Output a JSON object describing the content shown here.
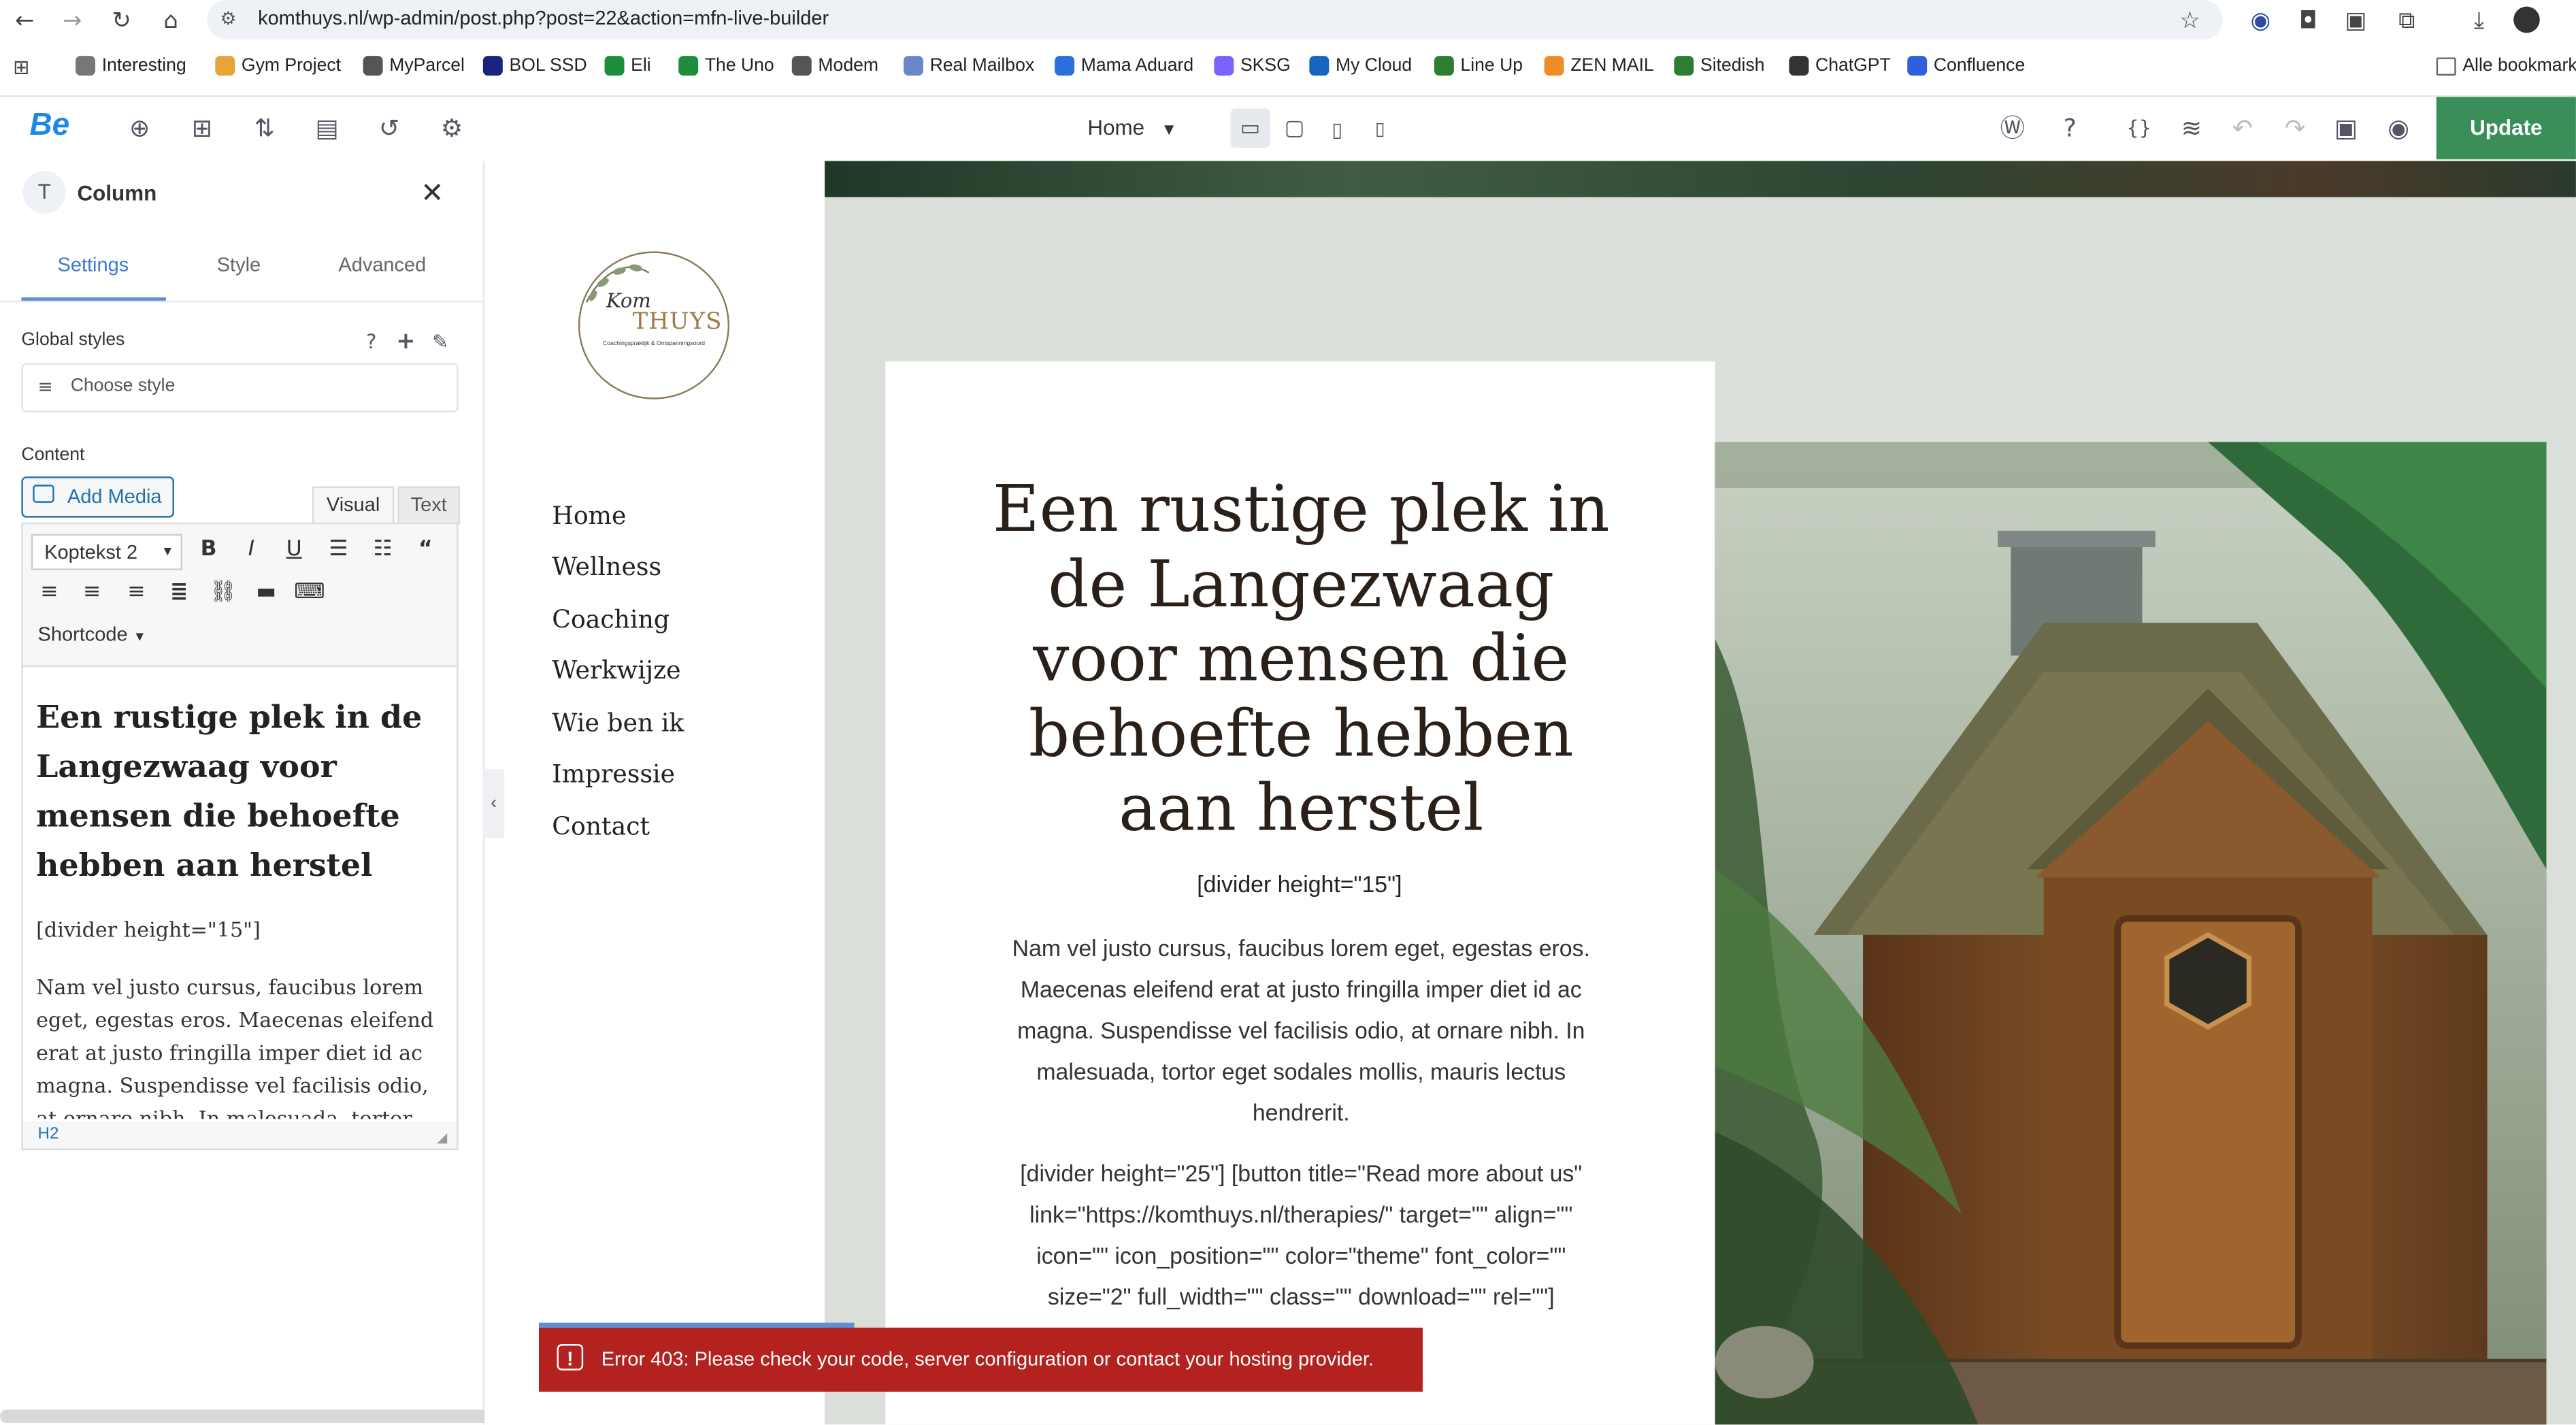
{
  "browser": {
    "url": "komthuys.nl/wp-admin/post.php?post=22&action=mfn-live-builder",
    "bookmarks": [
      "Interesting",
      "Gym Project",
      "MyParcel",
      "BOL SSD",
      "Eli",
      "The Uno",
      "Modem",
      "Real Mailbox",
      "Mama Aduard",
      "SKSG",
      "My Cloud",
      "Line Up",
      "ZEN MAIL",
      "Sitedish",
      "ChatGPT",
      "Confluence"
    ],
    "bookmarks_folder": "Alle bookmarks"
  },
  "builder": {
    "logo": "Be",
    "page": "Home",
    "update_label": "Update"
  },
  "panel": {
    "icon_letter": "T",
    "title": "Column",
    "tabs": [
      "Settings",
      "Style",
      "Advanced"
    ],
    "global_styles_label": "Global styles",
    "choose_style": "Choose style",
    "content_label": "Content",
    "add_media": "Add Media",
    "editor_tabs": {
      "visual": "Visual",
      "text": "Text"
    },
    "format": "Koptekst 2",
    "shortcode": "Shortcode",
    "editor_heading": "Een rustige plek in de Langezwaag voor mensen die behoefte hebben aan herstel",
    "editor_divider": "[divider height=\"15\"]",
    "editor_paragraph": "Nam vel justo cursus, faucibus lorem eget, egestas eros. Maecenas eleifend erat at justo fringilla imper diet id ac magna. Suspendisse vel facilisis odio, at ornare nibh. In malesuada, tortor eget sodales",
    "status_path": "H2"
  },
  "preview": {
    "logo_script": "Kom",
    "logo_word": "THUYS",
    "logo_sub": "Coachingspraktijk & Ontspanningsoord",
    "nav": [
      "Home",
      "Wellness",
      "Coaching",
      "Werkwijze",
      "Wie ben ik",
      "Impressie",
      "Contact"
    ],
    "heading": "Een rustige plek in de Langezwaag voor mensen die behoefte hebben aan herstel",
    "divider": "[divider height=\"15\"]",
    "paragraph": "Nam vel justo cursus, faucibus lorem eget, egestas eros. Maecenas eleifend erat at justo fringilla imper diet id ac magna. Suspendisse vel facilisis odio, at ornare nibh. In malesuada, tortor eget sodales mollis, mauris lectus hendrerit.",
    "button_code": "[divider height=\"25\"] [button title=\"Read more about us\" link=\"https://komthuys.nl/therapies/\" target=\"\" align=\"\" icon=\"\" icon_position=\"\" color=\"theme\" font_color=\"\" size=\"2\" full_width=\"\" class=\"\" download=\"\" rel=\"\"]"
  },
  "error": {
    "message": "Error 403: Please check your code, server configuration or contact your hosting provider."
  },
  "colors": {
    "accent": "#1e88e5",
    "update": "#3a8f58",
    "error": "#b3221f",
    "sage": "#dadfda"
  }
}
